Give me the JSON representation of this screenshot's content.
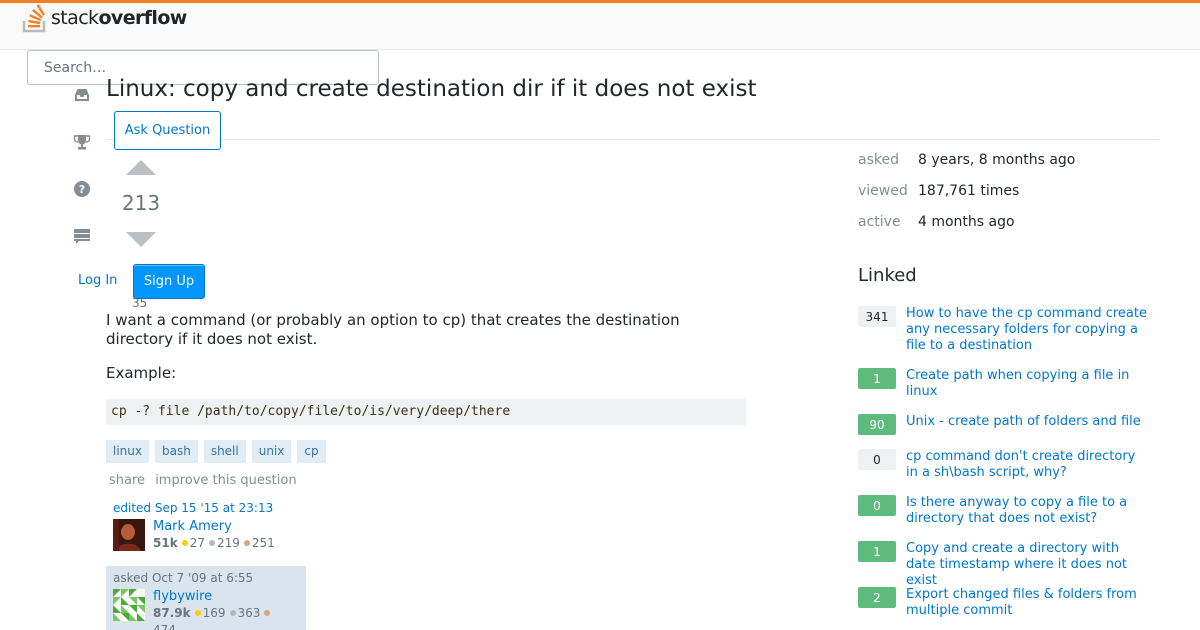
{
  "header": {
    "logo_light": "stack",
    "logo_bold": "overflow",
    "search_placeholder": "Search…"
  },
  "nav_icons": [
    "inbox-icon",
    "trophy-icon",
    "help-icon",
    "review-queue-icon"
  ],
  "question": {
    "title": "Linux: copy and create destination dir if it does not exist",
    "ask_button": "Ask Question",
    "votes": "213",
    "favorites": "35",
    "body": [
      "I want a command (or probably an option to cp) that creates the destination directory if it does not exist.",
      "Example:"
    ],
    "code": "cp -? file /path/to/copy/file/to/is/very/deep/there",
    "tags": [
      "linux",
      "bash",
      "shell",
      "unix",
      "cp"
    ],
    "menu": [
      "share",
      "improve this question"
    ]
  },
  "auth": {
    "login": "Log In",
    "signup": "Sign Up"
  },
  "editor": {
    "action": "edited Sep 15 '15 at 23:13",
    "name": "Mark Amery",
    "rep": "51k",
    "gold": "27",
    "silver": "219",
    "bronze": "251"
  },
  "asker": {
    "action": "asked Oct 7 '09 at 6:55",
    "name": "flybywire",
    "rep": "87.9k",
    "gold": "169",
    "silver": "363",
    "bronze": "474"
  },
  "stats": [
    {
      "label": "asked",
      "value": "8 years, 8 months ago"
    },
    {
      "label": "viewed",
      "value": "187,761 times"
    },
    {
      "label": "active",
      "value": "4 months ago"
    }
  ],
  "linked": {
    "title": "Linked",
    "items": [
      {
        "score": "341",
        "accepted": false,
        "text": "How to have the cp command create any necessary folders for copying a file to a destination"
      },
      {
        "score": "1",
        "accepted": true,
        "text": "Create path when copying a file in linux"
      },
      {
        "score": "90",
        "accepted": true,
        "text": "Unix - create path of folders and file"
      },
      {
        "score": "0",
        "accepted": false,
        "text": "cp command don't create directory in a sh\\bash script, why?"
      },
      {
        "score": "0",
        "accepted": true,
        "text": "Is there anyway to copy a file to a directory that does not exist?"
      },
      {
        "score": "1",
        "accepted": true,
        "text": "Copy and create a directory with date timestamp where it does not exist"
      },
      {
        "score": "2",
        "accepted": true,
        "text": "Export changed files & folders from multiple commit"
      }
    ]
  },
  "colors": {
    "accent": "#f48024",
    "link": "#0077cc",
    "accepted": "#5eba7d",
    "primary_button": "#0095ff"
  }
}
